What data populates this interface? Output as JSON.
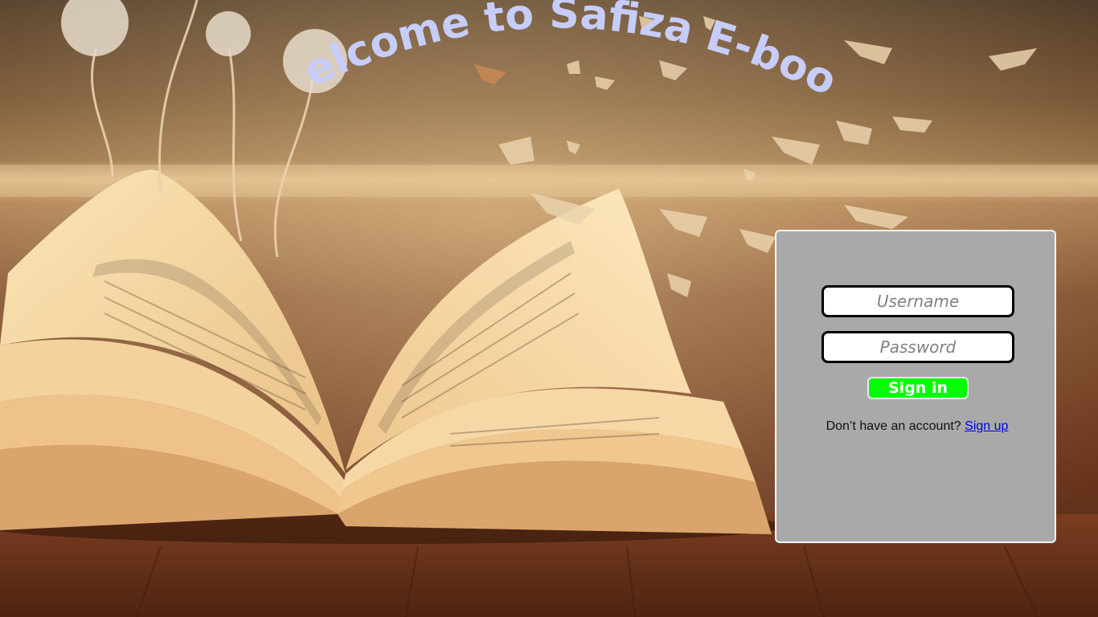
{
  "page": {
    "welcome_title": "Welcome to Safiza E-book"
  },
  "login": {
    "username_placeholder": "Username",
    "password_placeholder": "Password",
    "signin_label": "Sign in",
    "no_account_text": "Don’t have an account?",
    "signup_label": "Sign up"
  },
  "colors": {
    "title": "#c7cdfb",
    "panel": "#a9a9a9",
    "signin_button": "#00ff00",
    "link": "#0000ee"
  }
}
